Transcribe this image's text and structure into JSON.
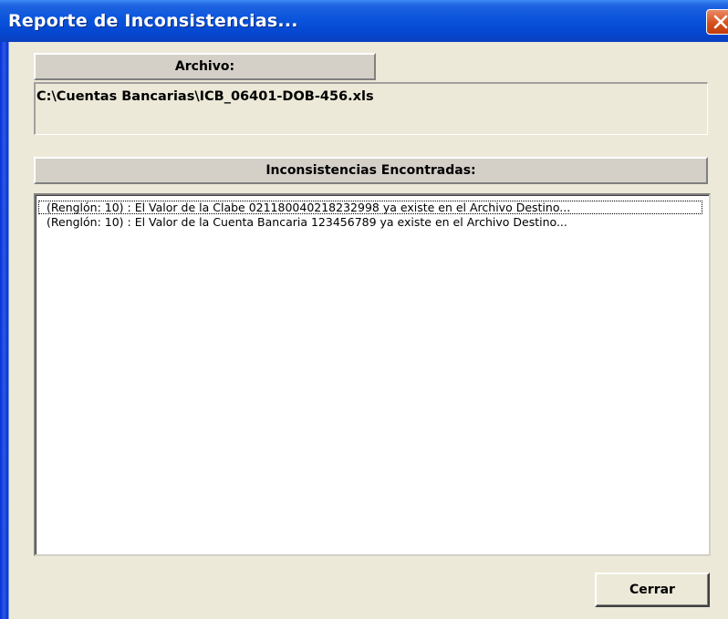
{
  "window": {
    "title": "Reporte de Inconsistencias..."
  },
  "archivo": {
    "header": "Archivo:",
    "path": "C:\\Cuentas Bancarias\\ICB_06401-DOB-456.xls"
  },
  "inconsistencias": {
    "header": "Inconsistencias Encontradas:",
    "items": [
      "(Renglón: 10) : El Valor de la Clabe 021180040218232998 ya existe en el Archivo Destino...",
      "(Renglón: 10) : El Valor de la Cuenta Bancaria 123456789 ya existe en el Archivo Destino..."
    ]
  },
  "buttons": {
    "close_label": "Cerrar"
  },
  "icons": {
    "close": "close-icon"
  },
  "colors": {
    "titlebar": "#0a54dc",
    "close_button": "#d6501e",
    "dialog_bg": "#ece9d8"
  }
}
